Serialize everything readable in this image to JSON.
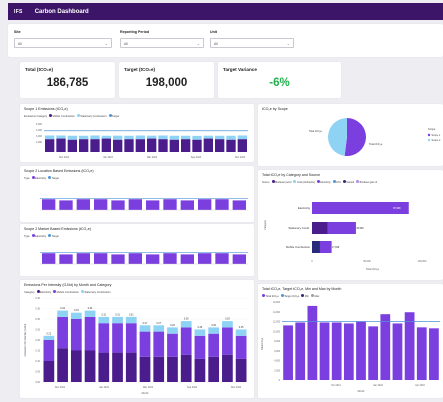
{
  "header": {
    "logo": "IFS",
    "title": "Carbon Dashboard"
  },
  "filters": [
    {
      "label": "Site",
      "value": "All"
    },
    {
      "label": "Reporting Period",
      "value": "All"
    },
    {
      "label": "Unit",
      "value": "All"
    }
  ],
  "kpis": [
    {
      "label": "Total (tCO₂e)",
      "value": "186,785"
    },
    {
      "label": "Target (tCO₂e)",
      "value": "198,000"
    },
    {
      "label": "Target Variance",
      "value": "-6%"
    }
  ],
  "colors": {
    "header": "#3c1468",
    "dark_purple": "#4b1d8c",
    "purple": "#7b3fe0",
    "light_blue": "#8fd3f4",
    "target_line": "#4e95d9",
    "variance_green": "#22b14c"
  },
  "charts": {
    "scope1": {
      "title": "Scope 1 Emissions (tCO₂e)",
      "legend_title": "Emissions Category",
      "legend": [
        "Mobile Combustion",
        "Stationary Combustion",
        "Target"
      ],
      "y_ticks": [
        "5,000",
        "4,000",
        "3,000",
        "2,000"
      ],
      "x_ticks": [
        "Nov 2021",
        "Jan 2022",
        "Mar 2022",
        "Sep 2022",
        "Nov 2022"
      ]
    },
    "scope2_loc": {
      "title": "Scope 2 Location Based Emissions (tCO₂e)",
      "legend_title": "Type",
      "legend": [
        "Electricity",
        "Target"
      ]
    },
    "scope2_mkt": {
      "title": "Scope 2 Market Based Emissions (tCO₂e)",
      "legend_title": "Type",
      "legend": [
        "Electricity",
        "Target"
      ]
    },
    "intensity": {
      "title": "Emissions Per Intensity (GJ/kt) by Month and Category",
      "legend_title": "Category",
      "legend": [
        "Electricity",
        "Mobile Combustion",
        "Stationary Combustion"
      ],
      "y_label": "Emissions Per Intensity (GJ/kt)",
      "y_ticks": [
        "0.40",
        "0.35",
        "0.30",
        "0.25",
        "0.20",
        "0.15",
        "0.10",
        "0.05",
        "0.00"
      ],
      "data_labels": [
        "0.22",
        "0.34",
        "0.33",
        "0.34",
        "0.31",
        "0.31",
        "0.31",
        "0.27",
        "0.27",
        "0.26",
        "0.29",
        "0.25",
        "0.26",
        "0.29",
        "0.25"
      ],
      "x_ticks": [
        "Nov 2021",
        "Jan 2022",
        "Mar 2022",
        "Sep 2022",
        "Nov 2022"
      ],
      "x_label": "Month"
    },
    "by_scope": {
      "title": "tCO₂e by Scope",
      "labels": [
        "Total tCO₂e",
        "Total tCO₂e"
      ],
      "legend_title": "Scope",
      "legend": [
        "Scope 1",
        "Scope 2"
      ]
    },
    "by_category": {
      "title": "Total tCO₂e by Category and Source",
      "legend_title": "Source",
      "legend": [
        "Biodiesel petrol",
        "Coal (Anthracite)",
        "Electricity",
        "LPG",
        "Natural",
        "Biodiesel gas oil"
      ],
      "categories": [
        "Electricity",
        "Stationary Comb.",
        "Mobile Combustion"
      ],
      "data_labels": [
        "87,968",
        "39,938",
        "17,828"
      ],
      "y_label": "Category",
      "x_ticks": [
        "0",
        "50,000",
        "100,000"
      ],
      "x_label": "Total tCO₂e"
    },
    "target_vs": {
      "title": "Total tCO₂e, Target tCO₂e, Min and Max by Month",
      "legend": [
        "Total tCO₂e",
        "Target tCO₂e",
        "Min",
        "Max"
      ],
      "y_ticks": [
        "16,000",
        "14,000",
        "12,000",
        "10,000",
        "8,000",
        "6,000",
        "4,000",
        "2,000",
        "0"
      ],
      "y_label": "Total tCO₂e",
      "x_ticks": [
        "Oct 2021",
        "Jan 2022",
        "Apr 2022"
      ],
      "x_label": "Month"
    }
  },
  "chart_data": [
    {
      "type": "bar",
      "name": "scope1",
      "series": [
        {
          "name": "Mobile Combustion",
          "values": [
            2300,
            2400,
            2200,
            2300,
            2300,
            2400,
            2200,
            2300,
            2300,
            2400,
            2300,
            2200,
            2300,
            2200,
            2400,
            2300,
            2200,
            2300
          ]
        },
        {
          "name": "Stationary Combustion",
          "values": [
            650,
            550,
            700,
            600,
            650,
            500,
            720,
            600,
            650,
            520,
            650,
            700,
            600,
            680,
            520,
            600,
            700,
            650
          ]
        },
        {
          "name": "Target",
          "values": [
            3800,
            3800,
            3800,
            3800,
            3800,
            3800,
            3800,
            3800,
            3800,
            3800,
            3800,
            3800,
            3800,
            3800,
            3800,
            3800,
            3800,
            3800
          ]
        }
      ],
      "ylim": [
        0,
        5000
      ]
    },
    {
      "type": "bar",
      "name": "scope2_loc",
      "series": [
        {
          "name": "Electricity",
          "values": [
            9,
            8,
            9,
            9,
            8,
            9,
            8,
            9,
            8,
            9,
            9,
            8
          ]
        }
      ]
    },
    {
      "type": "bar",
      "name": "scope2_mkt",
      "series": [
        {
          "name": "Electricity",
          "values": [
            9,
            8,
            9,
            9,
            8,
            9,
            8,
            9,
            8,
            9,
            9,
            8
          ]
        }
      ]
    },
    {
      "type": "bar",
      "name": "intensity",
      "ylim": [
        0,
        0.4
      ],
      "series": [
        {
          "name": "Electricity",
          "values": [
            0.1,
            0.16,
            0.15,
            0.15,
            0.14,
            0.14,
            0.14,
            0.12,
            0.12,
            0.12,
            0.13,
            0.11,
            0.12,
            0.13,
            0.11
          ]
        },
        {
          "name": "Mobile Combustion",
          "values": [
            0.1,
            0.15,
            0.15,
            0.16,
            0.14,
            0.14,
            0.14,
            0.12,
            0.12,
            0.11,
            0.13,
            0.11,
            0.11,
            0.13,
            0.11
          ]
        },
        {
          "name": "Stationary Combustion",
          "values": [
            0.02,
            0.03,
            0.03,
            0.03,
            0.03,
            0.03,
            0.03,
            0.03,
            0.03,
            0.03,
            0.03,
            0.03,
            0.03,
            0.03,
            0.03
          ]
        }
      ]
    },
    {
      "type": "pie",
      "name": "by_scope",
      "values": [
        52,
        48
      ],
      "labels": [
        "Scope 1",
        "Scope 2"
      ]
    },
    {
      "type": "bar",
      "name": "by_category",
      "categories": [
        "Electricity",
        "Stationary Comb.",
        "Mobile Combustion"
      ],
      "values": [
        87968,
        39938,
        17828
      ]
    },
    {
      "type": "bar",
      "name": "target_vs",
      "ylim": [
        0,
        16000
      ],
      "series": [
        {
          "name": "Total tCO₂e",
          "values": [
            11200,
            11800,
            15200,
            11800,
            11800,
            11600,
            12000,
            11000,
            13500,
            11600,
            13900,
            10800,
            10600
          ]
        },
        {
          "name": "Target tCO₂e",
          "values": [
            12000,
            12000,
            12000,
            12000,
            12000,
            12000,
            12000,
            12000,
            12000,
            12000,
            12000,
            12000,
            12000
          ]
        }
      ]
    }
  ]
}
